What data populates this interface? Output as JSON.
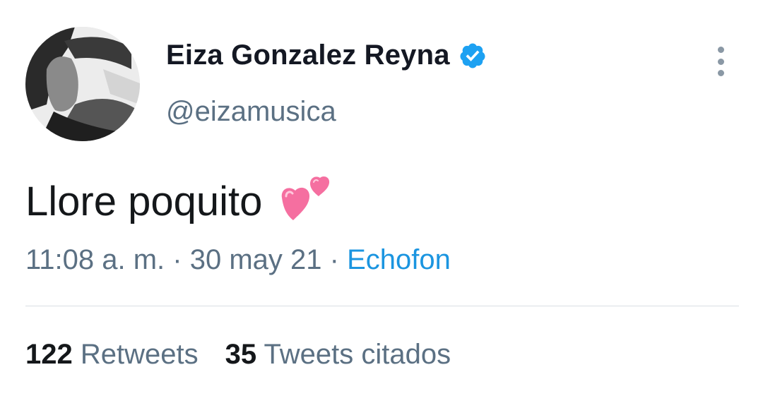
{
  "author": {
    "display_name": "Eiza Gonzalez Reyna",
    "handle": "@eizamusica",
    "verified": true
  },
  "tweet": {
    "text": "Llore poquito",
    "emoji": "two-hearts-emoji"
  },
  "meta": {
    "time": "11:08 a. m.",
    "separator": "·",
    "date": "30 may 21",
    "source": "Echofon"
  },
  "stats": {
    "retweets_count": "122",
    "retweets_label": "Retweets",
    "quotes_count": "35",
    "quotes_label": "Tweets citados"
  },
  "colors": {
    "text": "#14171a",
    "secondary": "#5b7083",
    "link": "#1b95e0",
    "verified": "#1da1f2",
    "divider": "#d9dee3"
  }
}
